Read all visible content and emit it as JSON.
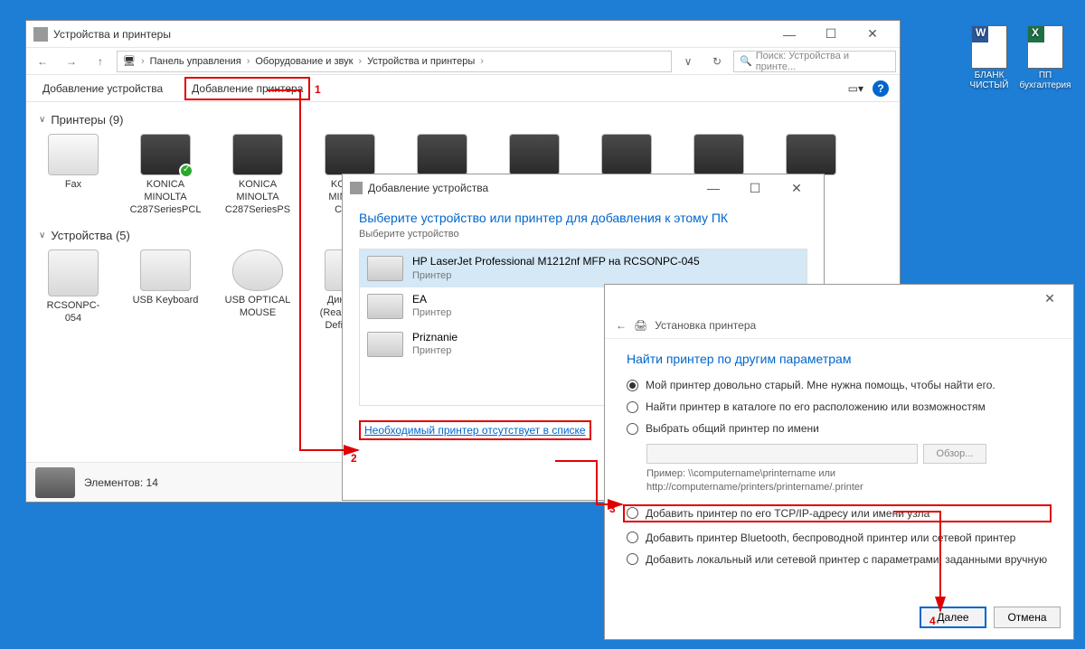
{
  "main": {
    "title": "Устройства и принтеры",
    "breadcrumb": [
      "Панель управления",
      "Оборудование и звук",
      "Устройства и принтеры"
    ],
    "search_placeholder": "Поиск: Устройства и принте...",
    "toolbar": {
      "add_device": "Добавление устройства",
      "add_printer": "Добавление принтера"
    },
    "groups": {
      "printers": {
        "label": "Принтеры (9)",
        "items": [
          "Fax",
          "KONICA MINOLTA C287SeriesPCL",
          "KONICA MINOLTA C287SeriesPS",
          "KONICA MINOLTA C287S"
        ]
      },
      "devices": {
        "label": "Устройства (5)",
        "items": [
          "RCSONPC-054",
          "USB Keyboard",
          "USB OPTICAL MOUSE",
          "Динамики (Realtek High Definition..."
        ]
      }
    },
    "status": "Элементов: 14"
  },
  "dlg2": {
    "title": "Добавление устройства",
    "h1": "Выберите устройство или принтер для добавления к этому ПК",
    "sub": "Выберите устройство",
    "items": [
      {
        "name": "HP LaserJet Professional M1212nf MFP на RCSONPC-045",
        "type": "Принтер"
      },
      {
        "name": "EA",
        "type": "Принтер"
      },
      {
        "name": "Priznanie",
        "type": "Принтер"
      }
    ],
    "link": "Необходимый принтер отсутствует в списке"
  },
  "dlg3": {
    "crumb": "Установка принтера",
    "h1": "Найти принтер по другим параметрам",
    "opts": [
      "Мой принтер довольно старый. Мне нужна помощь, чтобы найти его.",
      "Найти принтер в каталоге по его расположению или возможностям",
      "Выбрать общий принтер по имени",
      "Добавить принтер по его TCP/IP-адресу или имени узла",
      "Добавить принтер Bluetooth, беспроводной принтер или сетевой принтер",
      "Добавить локальный или сетевой принтер с параметрами, заданными вручную"
    ],
    "browse": "Обзор...",
    "example": "Пример: \\\\computername\\printername или http://computername/printers/printername/.printer",
    "next": "Далее",
    "cancel": "Отмена"
  },
  "desktop": {
    "word": "БЛАНК ЧИСТЫЙ",
    "excel": "ПП бухгалтерия"
  },
  "labels": {
    "1": "1",
    "2": "2",
    "3": "3",
    "4": "4"
  }
}
